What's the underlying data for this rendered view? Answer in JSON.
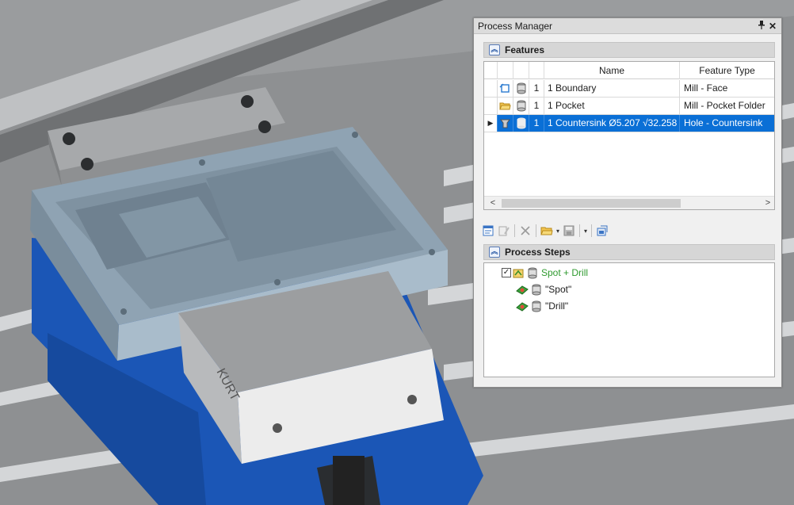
{
  "panel": {
    "title": "Process Manager",
    "pin_glyph": "❒",
    "close_glyph": "✕"
  },
  "features": {
    "header": "Features",
    "columns": {
      "name": "Name",
      "feature_type": "Feature Type"
    },
    "rows": [
      {
        "number": "1",
        "name": "1 Boundary",
        "type": "Mill - Face",
        "icon": "boundary-icon",
        "selected": false
      },
      {
        "number": "1",
        "name": "1 Pocket",
        "type": "Mill - Pocket Folder",
        "icon": "folder-icon",
        "selected": false
      },
      {
        "number": "1",
        "name": "1 Countersink Ø5.207 √32.258",
        "type": "Hole - Countersink",
        "icon": "countersink-icon",
        "selected": true
      }
    ],
    "scroll_left": "<",
    "scroll_right": ">"
  },
  "toolbar": {
    "items": [
      "new-feature-icon",
      "edit-icon",
      "delete-icon",
      "open-folder-icon",
      "save-icon",
      "export-icon"
    ]
  },
  "process_steps": {
    "header": "Process Steps",
    "items": [
      {
        "label": "Spot + Drill",
        "checked": true,
        "level": 0
      },
      {
        "label": "\"Spot\"",
        "level": 1
      },
      {
        "label": "\"Drill\"",
        "level": 1
      }
    ]
  },
  "scene": {
    "vise_brand": "KURT",
    "colors": {
      "vise_blue": "#1a5bbf",
      "part_gray": "#8ea2b1",
      "selection_blue": "#0a6fd6"
    }
  }
}
